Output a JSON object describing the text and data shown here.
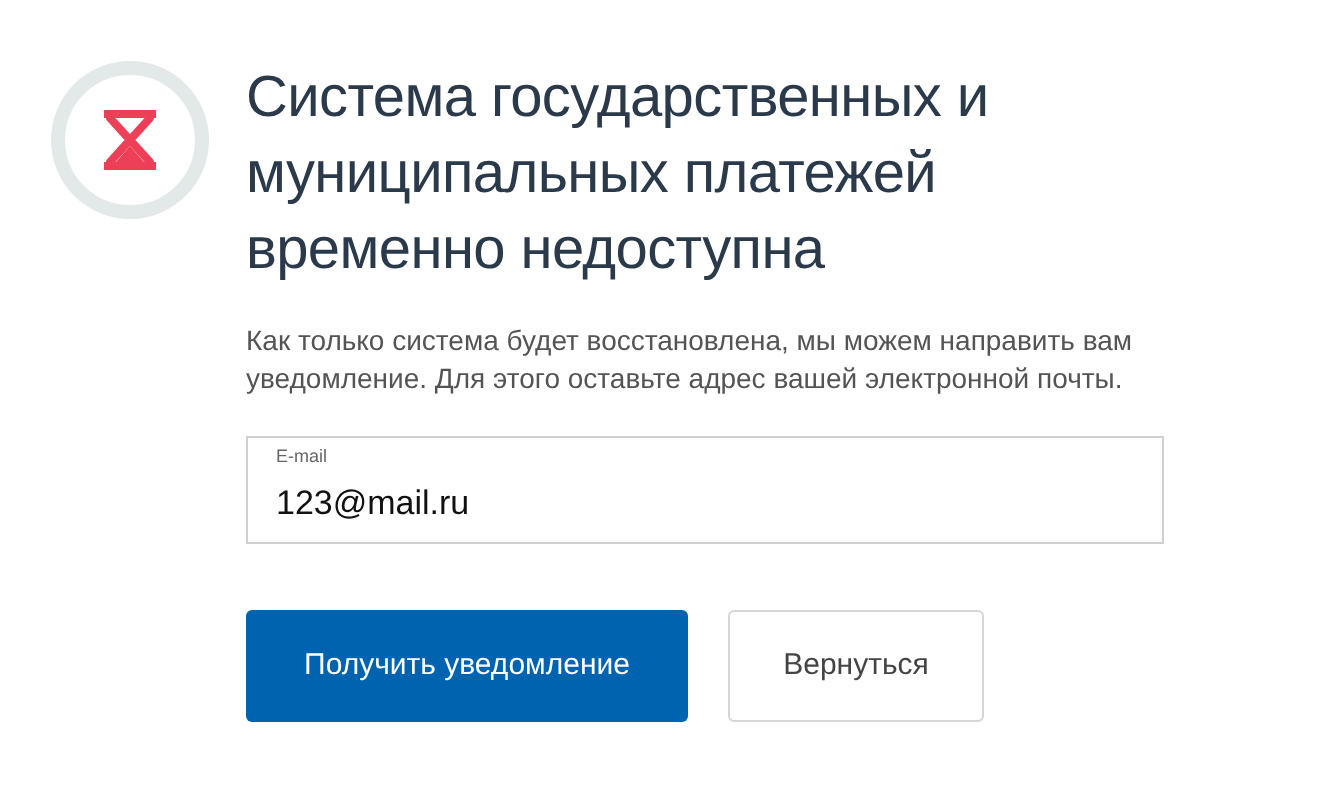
{
  "title": "Система государственных и муниципальных платежей временно недоступна",
  "message": "Как только система будет восстановлена, мы можем направить вам уведомление. Для этого оставьте адрес вашей электронной почты.",
  "email_field": {
    "label": "E-mail",
    "value": "123@mail.ru"
  },
  "buttons": [
    {
      "label": "Получить уведомление",
      "kind": "primary"
    },
    {
      "label": "Вернуться",
      "kind": "secondary"
    }
  ]
}
